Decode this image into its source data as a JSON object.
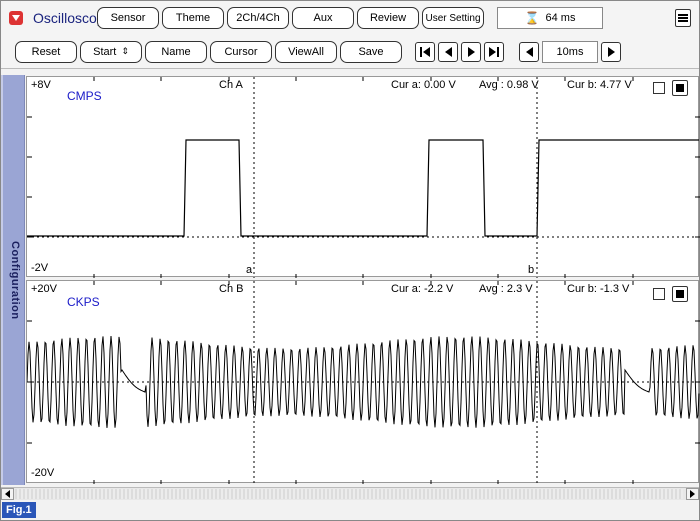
{
  "app": {
    "title": "Oscilloscope"
  },
  "toolbar_top": {
    "buttons": [
      "Sensor",
      "Theme",
      "2Ch/4Ch",
      "Aux",
      "Review",
      "User Setting"
    ],
    "sample_time": "64 ms"
  },
  "toolbar_bottom": {
    "buttons": [
      "Reset",
      "Start",
      "Name",
      "Cursor",
      "ViewAll",
      "Save"
    ],
    "zoom": "10ms"
  },
  "side_tab": {
    "label": "Configuration"
  },
  "channel_a": {
    "channel": "Ch A",
    "signal": "CMPS",
    "y_max": "+8V",
    "y_min": "-2V",
    "cursor_a": "Cur a: 0.00 V",
    "avg": "Avg  : 0.98 V",
    "cursor_b": "Cur b: 4.77 V",
    "cursor_a_marker": "a",
    "cursor_b_marker": "b"
  },
  "channel_b": {
    "channel": "Ch B",
    "signal": "CKPS",
    "y_max": "+20V",
    "y_min": "-20V",
    "cursor_a": "Cur a: -2.2 V",
    "avg": "Avg  : 2.3 V",
    "cursor_b": "Cur b: -1.3 V"
  },
  "figure": {
    "label": "Fig.1"
  },
  "colors": {
    "accent": "#1a237e",
    "signal_label": "#1a1ac8",
    "side_tab": "#9aa5d4",
    "fig_label": "#2a56b8"
  }
}
